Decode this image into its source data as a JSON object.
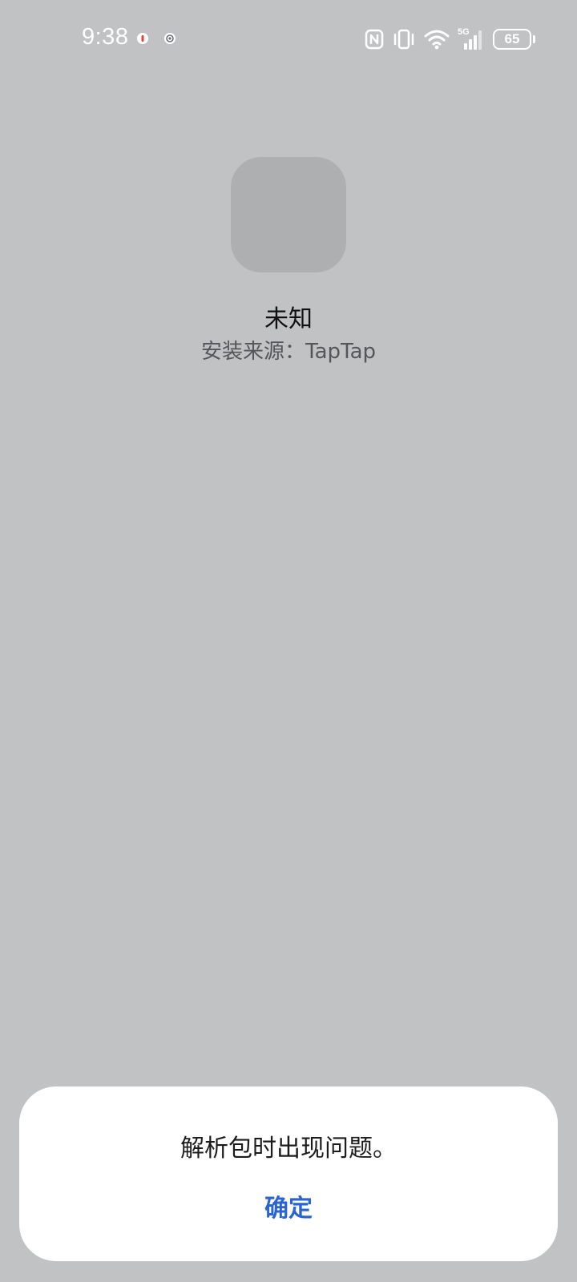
{
  "status_bar": {
    "time": "9:38",
    "battery_level": "65",
    "network_type": "5G",
    "icons": [
      "record-icon",
      "vpn-icon",
      "nfc-icon",
      "vibrate-icon",
      "wifi-icon",
      "signal-icon",
      "battery-icon"
    ]
  },
  "app": {
    "name": "未知",
    "source": "安装来源：TapTap"
  },
  "dialog": {
    "message": "解析包时出现问题。",
    "confirm_label": "确定"
  },
  "colors": {
    "background": "#c1c2c4",
    "accent": "#2a64d4"
  }
}
